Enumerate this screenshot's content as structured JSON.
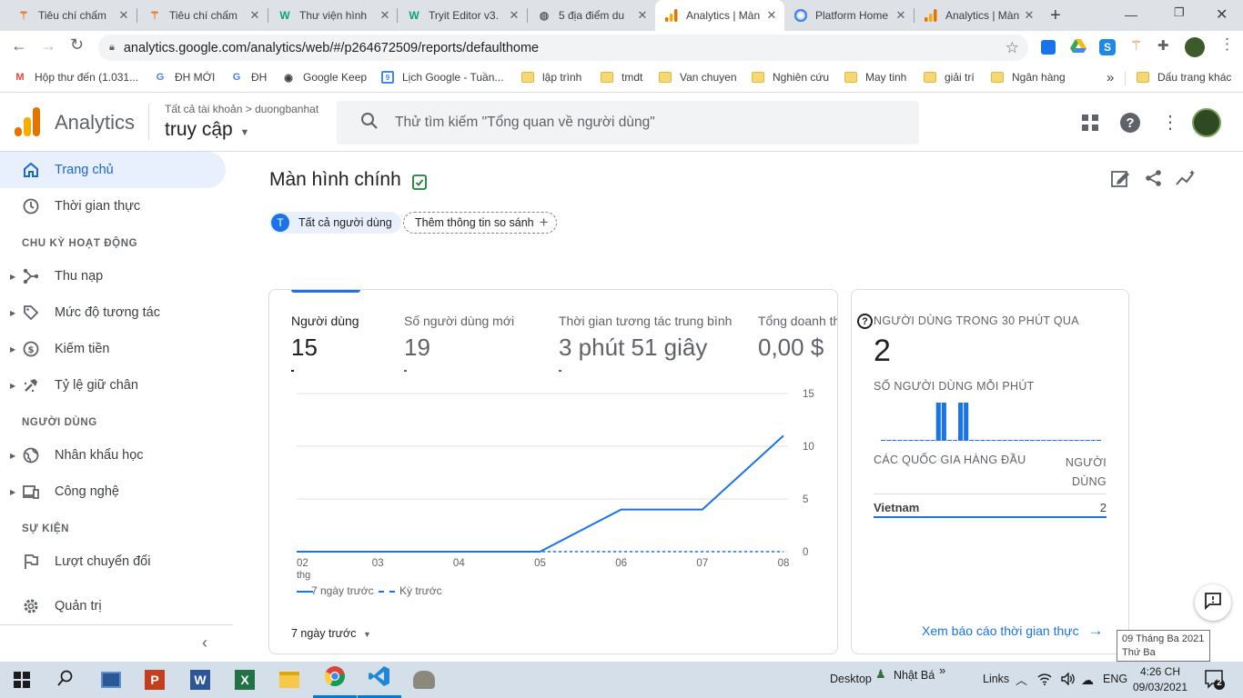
{
  "browser": {
    "tabs": [
      {
        "title": "Tiêu chí chấm",
        "icon": "person-icon",
        "active": false
      },
      {
        "title": "Tiêu chí chấm",
        "icon": "person-icon",
        "active": false
      },
      {
        "title": "Thư viện hình",
        "icon": "w-icon",
        "active": false
      },
      {
        "title": "Tryit Editor v3.",
        "icon": "w-icon",
        "active": false
      },
      {
        "title": "5 địa điểm du",
        "icon": "globe-icon",
        "active": false
      },
      {
        "title": "Analytics | Màn",
        "icon": "analytics-icon",
        "active": true
      },
      {
        "title": "Platform Home",
        "icon": "google-icon",
        "active": false
      },
      {
        "title": "Analytics | Màn",
        "icon": "analytics-icon",
        "active": false
      }
    ],
    "url": "analytics.google.com/analytics/web/#/p264672509/reports/defaulthome",
    "bookmarks": [
      {
        "label": "Hộp thư đến (1.031...",
        "icon": "gmail-icon"
      },
      {
        "label": "ĐH MỚI",
        "icon": "g-icon"
      },
      {
        "label": "ĐH",
        "icon": "g-icon"
      },
      {
        "label": "Google Keep",
        "icon": "globe-icon"
      },
      {
        "label": "Lịch Google - Tuần...",
        "icon": "calendar-icon"
      },
      {
        "label": "lập trình",
        "icon": "folder-icon"
      },
      {
        "label": "tmdt",
        "icon": "folder-icon"
      },
      {
        "label": "Van chuyen",
        "icon": "folder-icon"
      },
      {
        "label": "Nghiên cứu",
        "icon": "folder-icon"
      },
      {
        "label": "May tinh",
        "icon": "folder-icon"
      },
      {
        "label": "giải trí",
        "icon": "folder-icon"
      },
      {
        "label": "Ngân hàng",
        "icon": "folder-icon"
      }
    ],
    "bookmarks_more": "»",
    "other_bookmarks": "Dấu trang khác"
  },
  "ga": {
    "product": "Analytics",
    "breadcrumb_root": "Tất cả tài khoản",
    "breadcrumb_sep": ">",
    "account": "duongbanhat",
    "property": "truy cập",
    "search_placeholder": "Thử tìm kiếm \"Tổng quan về người dùng\"",
    "nav": {
      "home": "Trang chủ",
      "realtime": "Thời gian thực",
      "lifecycle_title": "CHU KỲ HOẠT ĐỘNG",
      "acquisition": "Thu nạp",
      "engagement": "Mức độ tương tác",
      "monetization": "Kiếm tiền",
      "retention": "Tỷ lệ giữ chân",
      "user_title": "NGƯỜI DÙNG",
      "demographics": "Nhân khẩu học",
      "tech": "Công nghệ",
      "events_title": "SỰ KIỆN",
      "conversions": "Lượt chuyển đổi",
      "admin": "Quản trị"
    },
    "page_title": "Màn hình chính",
    "segment_letter": "T",
    "segment_label": "Tất cả người dùng",
    "compare_label": "Thêm thông tin so sánh",
    "metrics": [
      {
        "label": "Người dùng",
        "value": "15"
      },
      {
        "label": "Số người dùng mới",
        "value": "19"
      },
      {
        "label": "Thời gian tương tác trung bình",
        "value": "3 phút 51 giây"
      },
      {
        "label": "Tổng doanh thu",
        "value": "0,00 $"
      }
    ],
    "legend_current": "7 ngày trước",
    "legend_previous": "Kỳ trước",
    "date_range": "7 ngày trước",
    "realtime_card": {
      "title": "NGƯỜI DÙNG TRONG 30 PHÚT QUA",
      "value": "2",
      "per_minute_title": "SỐ NGƯỜI DÙNG MỖI PHÚT",
      "per_minute_values": [
        0,
        0,
        0,
        0,
        0,
        0,
        0,
        0,
        0,
        0,
        1,
        1,
        0,
        0,
        1,
        1,
        0,
        0,
        0,
        0,
        0,
        0,
        0,
        0,
        0,
        0,
        0,
        0,
        0,
        0,
        0,
        0,
        0,
        0,
        0,
        0,
        0,
        0,
        0,
        0
      ],
      "top_countries_title": "CÁC QUỐC GIA HÀNG ĐẦU",
      "users_col_line1": "NGƯỜI",
      "users_col_line2": "DÙNG",
      "country": "Vietnam",
      "country_value": "2",
      "link": "Xem báo cáo thời gian thực"
    }
  },
  "chart_data": {
    "type": "line",
    "x": [
      "02",
      "03",
      "04",
      "05",
      "06",
      "07",
      "08"
    ],
    "x_sublabel": "thg",
    "series": [
      {
        "name": "7 ngày trước",
        "values": [
          0,
          0,
          0,
          0,
          4,
          4,
          11
        ]
      },
      {
        "name": "Kỳ trước",
        "values": [
          0,
          0,
          0,
          0,
          0,
          0,
          0
        ]
      }
    ],
    "y_ticks": [
      "0",
      "5",
      "10",
      "15"
    ],
    "ylim": [
      0,
      15
    ],
    "grid": true,
    "colors": {
      "current": "#1a73e8",
      "previous": "#1a73e8"
    }
  },
  "taskbar": {
    "desktop": "Desktop",
    "user": "Nhật Bá",
    "links": "Links",
    "lang": "ENG",
    "time": "4:26 CH",
    "date": "09/03/2021",
    "tooltip_date": "09 Tháng Ba 2021",
    "tooltip_day": "Thứ Ba",
    "notif_count": "2"
  }
}
